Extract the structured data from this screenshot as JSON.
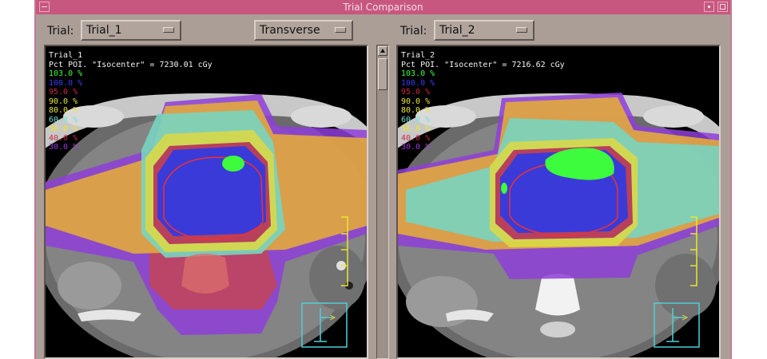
{
  "window": {
    "title": "Trial Comparison"
  },
  "left": {
    "trial_label": "Trial:",
    "trial_value": "Trial_1",
    "view_value": "Transverse",
    "overlay": {
      "name": "Trial_1",
      "poi": "Pct POI. \"Isocenter\" = 7230.01 cGy",
      "isodose": [
        {
          "label": "103.0 %",
          "color": "#3dfc3d"
        },
        {
          "label": "100.0 %",
          "color": "#3b3bf2"
        },
        {
          "label": "95.0 %",
          "color": "#c62a44"
        },
        {
          "label": "90.0 %",
          "color": "#e8e82a"
        },
        {
          "label": "80.0 %",
          "color": "#e8e82a"
        },
        {
          "label": "60.0 %",
          "color": "#6fe3d0"
        },
        {
          "label": "50.0 %",
          "color": "#e8e82a"
        },
        {
          "label": "40.0 %",
          "color": "#c62a44"
        },
        {
          "label": "30.0 %",
          "color": "#9c3bd6"
        }
      ]
    }
  },
  "right": {
    "trial_label": "Trial:",
    "trial_value": "Trial_2",
    "overlay": {
      "name": "Trial_2",
      "poi": "Pct POI. \"Isocenter\" = 7216.62 cGy",
      "isodose": [
        {
          "label": "103.0 %",
          "color": "#3dfc3d"
        },
        {
          "label": "100.0 %",
          "color": "#3b3bf2"
        },
        {
          "label": "95.0 %",
          "color": "#c62a44"
        },
        {
          "label": "90.0 %",
          "color": "#e8e82a"
        },
        {
          "label": "80.0 %",
          "color": "#e8e82a"
        },
        {
          "label": "60.0 %",
          "color": "#6fe3d0"
        },
        {
          "label": "50.0 %",
          "color": "#e8e82a"
        },
        {
          "label": "40.0 %",
          "color": "#c62a44"
        },
        {
          "label": "30.0 %",
          "color": "#9c3bd6"
        }
      ]
    }
  },
  "colors": {
    "titlebar": "#c8577f",
    "window_bg": "#ab9e97",
    "scale": "#e8e82a",
    "orientation": "#4fd0d8"
  }
}
